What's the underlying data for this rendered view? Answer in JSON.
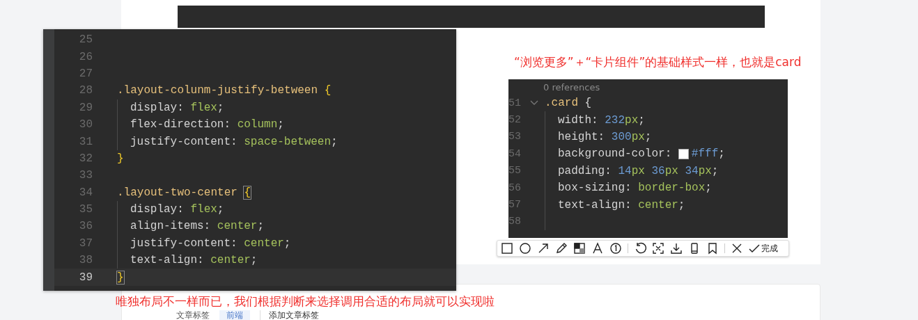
{
  "left_code": {
    "lines": [
      {
        "num": "25",
        "current": false
      },
      {
        "num": "26",
        "current": false
      },
      {
        "num": "27",
        "current": false
      },
      {
        "num": "28",
        "current": false,
        "tokens": [
          {
            "kind": "selector",
            "text": ".layout-colunm-justify-between "
          },
          {
            "kind": "brace",
            "text": "{"
          }
        ]
      },
      {
        "num": "29",
        "current": false,
        "indented": true,
        "tokens": [
          {
            "kind": "property",
            "text": "display: "
          },
          {
            "kind": "value",
            "text": "flex"
          },
          {
            "kind": "punct",
            "text": ";"
          }
        ]
      },
      {
        "num": "30",
        "current": false,
        "indented": true,
        "tokens": [
          {
            "kind": "property",
            "text": "flex-direction: "
          },
          {
            "kind": "value",
            "text": "column"
          },
          {
            "kind": "punct",
            "text": ";"
          }
        ]
      },
      {
        "num": "31",
        "current": false,
        "indented": true,
        "tokens": [
          {
            "kind": "property",
            "text": "justify-content: "
          },
          {
            "kind": "value",
            "text": "space-between"
          },
          {
            "kind": "punct",
            "text": ";"
          }
        ]
      },
      {
        "num": "32",
        "current": false,
        "tokens": [
          {
            "kind": "brace",
            "text": "}"
          }
        ]
      },
      {
        "num": "33",
        "current": false
      },
      {
        "num": "34",
        "current": false,
        "tokens": [
          {
            "kind": "selector",
            "text": ".layout-two-center "
          },
          {
            "kind": "bracket-match",
            "text": "{"
          }
        ]
      },
      {
        "num": "35",
        "current": false,
        "indented": true,
        "tokens": [
          {
            "kind": "property",
            "text": "display: "
          },
          {
            "kind": "value",
            "text": "flex"
          },
          {
            "kind": "punct",
            "text": ";"
          }
        ]
      },
      {
        "num": "36",
        "current": false,
        "indented": true,
        "tokens": [
          {
            "kind": "property",
            "text": "align-items: "
          },
          {
            "kind": "value",
            "text": "center"
          },
          {
            "kind": "punct",
            "text": ";"
          }
        ]
      },
      {
        "num": "37",
        "current": false,
        "indented": true,
        "tokens": [
          {
            "kind": "property",
            "text": "justify-content: "
          },
          {
            "kind": "value",
            "text": "center"
          },
          {
            "kind": "punct",
            "text": ";"
          }
        ]
      },
      {
        "num": "38",
        "current": false,
        "indented": true,
        "tokens": [
          {
            "kind": "property",
            "text": "text-align: "
          },
          {
            "kind": "value",
            "text": "center"
          },
          {
            "kind": "punct",
            "text": ";"
          }
        ]
      },
      {
        "num": "39",
        "current": true,
        "tokens": [
          {
            "kind": "bracket-match",
            "text": "}"
          }
        ]
      }
    ]
  },
  "annotation_top": "“浏览更多”＋“卡片组件”的基础样式一样，也就是card",
  "right_code": {
    "codelens": "0 references",
    "lines": [
      {
        "num": "51",
        "foldable": true,
        "tokens": [
          {
            "kind": "selector",
            "text": ".card "
          },
          {
            "kind": "punct",
            "text": "{"
          }
        ]
      },
      {
        "num": "52",
        "indented": true,
        "tokens": [
          {
            "kind": "property",
            "text": "width: "
          },
          {
            "kind": "number",
            "text": "232"
          },
          {
            "kind": "unit",
            "text": "px"
          },
          {
            "kind": "punct",
            "text": ";"
          }
        ]
      },
      {
        "num": "53",
        "indented": true,
        "tokens": [
          {
            "kind": "property",
            "text": "height: "
          },
          {
            "kind": "number",
            "text": "300"
          },
          {
            "kind": "unit",
            "text": "px"
          },
          {
            "kind": "punct",
            "text": ";"
          }
        ]
      },
      {
        "num": "54",
        "indented": true,
        "tokens": [
          {
            "kind": "property",
            "text": "background-color: "
          },
          {
            "kind": "swatch",
            "color": "#ffffff"
          },
          {
            "kind": "number",
            "text": "#fff"
          },
          {
            "kind": "punct",
            "text": ";"
          }
        ]
      },
      {
        "num": "55",
        "indented": true,
        "tokens": [
          {
            "kind": "property",
            "text": "padding: "
          },
          {
            "kind": "number",
            "text": "14"
          },
          {
            "kind": "unit",
            "text": "px "
          },
          {
            "kind": "number",
            "text": "36"
          },
          {
            "kind": "unit",
            "text": "px "
          },
          {
            "kind": "number",
            "text": "34"
          },
          {
            "kind": "unit",
            "text": "px"
          },
          {
            "kind": "punct",
            "text": ";"
          }
        ]
      },
      {
        "num": "56",
        "indented": true,
        "tokens": [
          {
            "kind": "property",
            "text": "box-sizing: "
          },
          {
            "kind": "value",
            "text": "border-box"
          },
          {
            "kind": "punct",
            "text": ";"
          }
        ]
      },
      {
        "num": "57",
        "indented": true,
        "tokens": [
          {
            "kind": "property",
            "text": "text-align: "
          },
          {
            "kind": "value",
            "text": "center"
          },
          {
            "kind": "punct",
            "text": ";"
          }
        ]
      },
      {
        "num": "58",
        "indented": true
      }
    ]
  },
  "toolbar": {
    "tools": [
      {
        "kind": "rectangle"
      },
      {
        "kind": "circle"
      },
      {
        "kind": "arrow"
      },
      {
        "kind": "pencil"
      },
      {
        "kind": "mosaic"
      },
      {
        "kind": "text"
      },
      {
        "kind": "number"
      },
      {
        "kind": "divider"
      },
      {
        "kind": "undo"
      },
      {
        "kind": "ocr"
      },
      {
        "kind": "download"
      },
      {
        "kind": "phone"
      },
      {
        "kind": "pin"
      },
      {
        "kind": "divider"
      },
      {
        "kind": "cancel"
      }
    ],
    "done": "完成"
  },
  "annotation_bottom": "唯独布局不一样而已，我们根据判断来选择调用合适的布局就可以实现啦",
  "tag_row": {
    "label": "文章标签",
    "tag": "前端",
    "add": "添加文章标签"
  }
}
